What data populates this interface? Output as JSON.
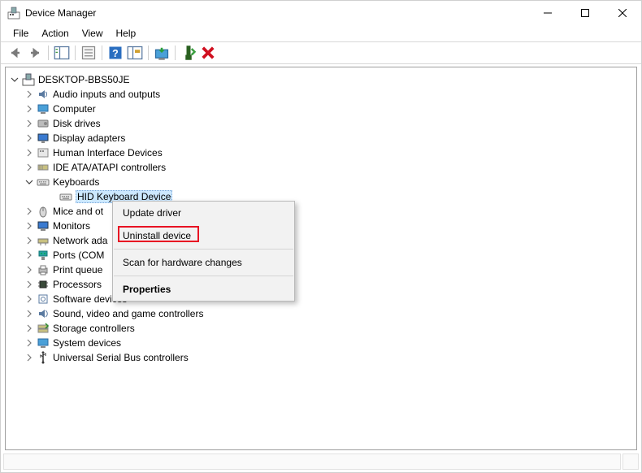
{
  "window": {
    "title": "Device Manager"
  },
  "menubar": {
    "file": "File",
    "action": "Action",
    "view": "View",
    "help": "Help"
  },
  "tree": {
    "root": "DESKTOP-BBS50JE",
    "items": [
      {
        "label": "Audio inputs and outputs",
        "expanded": false,
        "icon": "audio"
      },
      {
        "label": "Computer",
        "expanded": false,
        "icon": "computer"
      },
      {
        "label": "Disk drives",
        "expanded": false,
        "icon": "disk"
      },
      {
        "label": "Display adapters",
        "expanded": false,
        "icon": "display"
      },
      {
        "label": "Human Interface Devices",
        "expanded": false,
        "icon": "hid"
      },
      {
        "label": "IDE ATA/ATAPI controllers",
        "expanded": false,
        "icon": "ide"
      },
      {
        "label": "Keyboards",
        "expanded": true,
        "icon": "keyboard",
        "children": [
          {
            "label": "HID Keyboard Device",
            "selected": true,
            "icon": "keyboard"
          }
        ]
      },
      {
        "label": "Mice and ot",
        "expanded": false,
        "icon": "mouse"
      },
      {
        "label": "Monitors",
        "expanded": false,
        "icon": "monitor"
      },
      {
        "label": "Network ada",
        "expanded": false,
        "icon": "network"
      },
      {
        "label": "Ports (COM",
        "expanded": false,
        "icon": "port"
      },
      {
        "label": "Print queue",
        "expanded": false,
        "icon": "printer"
      },
      {
        "label": "Processors",
        "expanded": false,
        "icon": "cpu"
      },
      {
        "label": "Software devices",
        "expanded": false,
        "icon": "software"
      },
      {
        "label": "Sound, video and game controllers",
        "expanded": false,
        "icon": "sound"
      },
      {
        "label": "Storage controllers",
        "expanded": false,
        "icon": "storage"
      },
      {
        "label": "System devices",
        "expanded": false,
        "icon": "system"
      },
      {
        "label": "Universal Serial Bus controllers",
        "expanded": false,
        "icon": "usb"
      }
    ]
  },
  "context_menu": {
    "update_driver": "Update driver",
    "uninstall_device": "Uninstall device",
    "scan_hardware": "Scan for hardware changes",
    "properties": "Properties"
  }
}
